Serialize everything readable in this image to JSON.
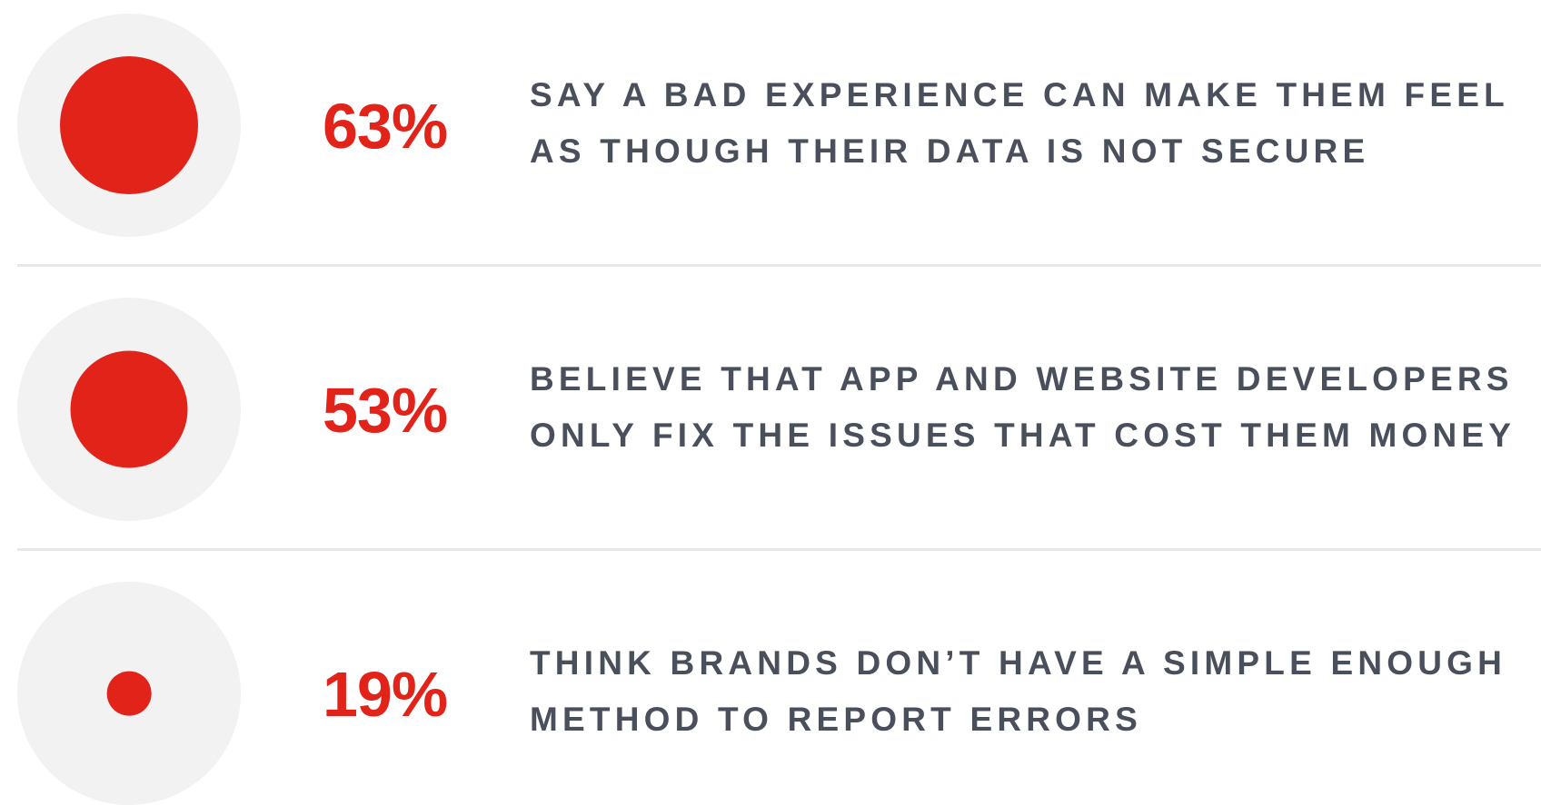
{
  "chart_data": {
    "type": "bubble",
    "unit": "%",
    "items": [
      {
        "value": 63,
        "label": "63%",
        "lines": [
          "SAY A BAD EXPERIENCE CAN MAKE THEM FEEL",
          "AS THOUGH THEIR DATA IS NOT SECURE"
        ]
      },
      {
        "value": 53,
        "label": "53%",
        "lines": [
          "BELIEVE THAT APP AND WEBSITE DEVELOPERS",
          "ONLY FIX THE ISSUES THAT COST THEM MONEY"
        ]
      },
      {
        "value": 19,
        "label": "19%",
        "lines": [
          "THINK BRANDS DON’T HAVE A SIMPLE ENOUGH",
          "METHOD TO REPORT ERRORS"
        ]
      }
    ]
  },
  "colors": {
    "accent": "#e2231a",
    "text": "#4a4f5c",
    "circle_background": "#f2f2f3",
    "divider": "#e8e8ea"
  }
}
